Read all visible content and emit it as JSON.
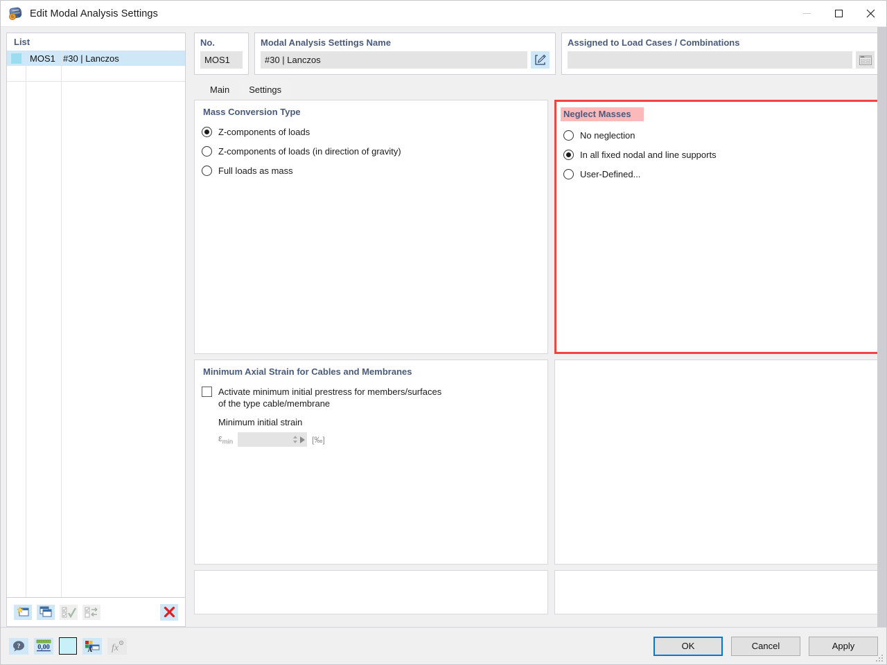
{
  "window": {
    "title": "Edit Modal Analysis Settings",
    "icon": "modal-analysis-icon",
    "minimize_label": "Minimize",
    "maximize_label": "Maximize",
    "close_label": "Close"
  },
  "list": {
    "header": "List",
    "rows": [
      {
        "no": "MOS1",
        "name": "#30 | Lanczos",
        "selected": true
      }
    ],
    "toolbar": [
      {
        "name": "new-item-button",
        "title": "New",
        "state": "enabled"
      },
      {
        "name": "copy-item-button",
        "title": "Copy",
        "state": "enabled"
      },
      {
        "name": "select-all-button",
        "title": "Select All",
        "state": "disabled"
      },
      {
        "name": "invert-selection-button",
        "title": "Invert Selection",
        "state": "disabled"
      },
      {
        "name": "delete-item-button",
        "title": "Delete",
        "state": "enabled"
      }
    ]
  },
  "fields": {
    "no": {
      "label": "No.",
      "value": "MOS1"
    },
    "name": {
      "label": "Modal Analysis Settings Name",
      "value": "#30 | Lanczos",
      "edit_button": "edit-name-button"
    },
    "assigned": {
      "label": "Assigned to Load Cases / Combinations",
      "value": "",
      "placeholder": "",
      "pick_button": "select-load-cases-button"
    }
  },
  "tabs": [
    {
      "label": "Main",
      "active": false
    },
    {
      "label": "Settings",
      "active": true
    }
  ],
  "settings": {
    "mass_conversion": {
      "title": "Mass Conversion Type",
      "options": [
        {
          "label": "Z-components of loads",
          "checked": true
        },
        {
          "label": "Z-components of loads (in direction of gravity)",
          "checked": false
        },
        {
          "label": "Full loads as mass",
          "checked": false
        }
      ]
    },
    "neglect_masses": {
      "title": "Neglect Masses",
      "title_highlight_color": "#fbb9b9",
      "outline_color": "#f5413f",
      "options": [
        {
          "label": "No neglection",
          "checked": false
        },
        {
          "label": "In all fixed nodal and line supports",
          "checked": true
        },
        {
          "label": "User-Defined...",
          "checked": false
        }
      ]
    },
    "min_axial_strain": {
      "title": "Minimum Axial Strain for Cables and Membranes",
      "checkbox": {
        "label_line1": "Activate minimum initial prestress for members/surfaces",
        "label_line2": "of the type cable/membrane",
        "checked": false
      },
      "sub_label": "Minimum initial strain",
      "field": {
        "symbol": "ε",
        "subscript": "min",
        "value": "",
        "unit": "[‰]",
        "enabled": false
      }
    }
  },
  "footer": {
    "icons": [
      {
        "name": "help-info-icon",
        "title": "Help",
        "state": "blue"
      },
      {
        "name": "decimal-places-icon",
        "title": "Number Format",
        "state": "blue",
        "text": "0,00"
      },
      {
        "name": "color-swatch-icon",
        "title": "Color",
        "state": "swatch",
        "color": "#c8f0f8"
      },
      {
        "name": "display-properties-icon",
        "title": "Display Properties",
        "state": "blue"
      },
      {
        "name": "formula-icon",
        "title": "Formula",
        "state": "gray"
      }
    ],
    "buttons": [
      {
        "label": "OK",
        "name": "ok-button",
        "primary": true
      },
      {
        "label": "Cancel",
        "name": "cancel-button",
        "primary": false
      },
      {
        "label": "Apply",
        "name": "apply-button",
        "primary": false
      }
    ]
  }
}
